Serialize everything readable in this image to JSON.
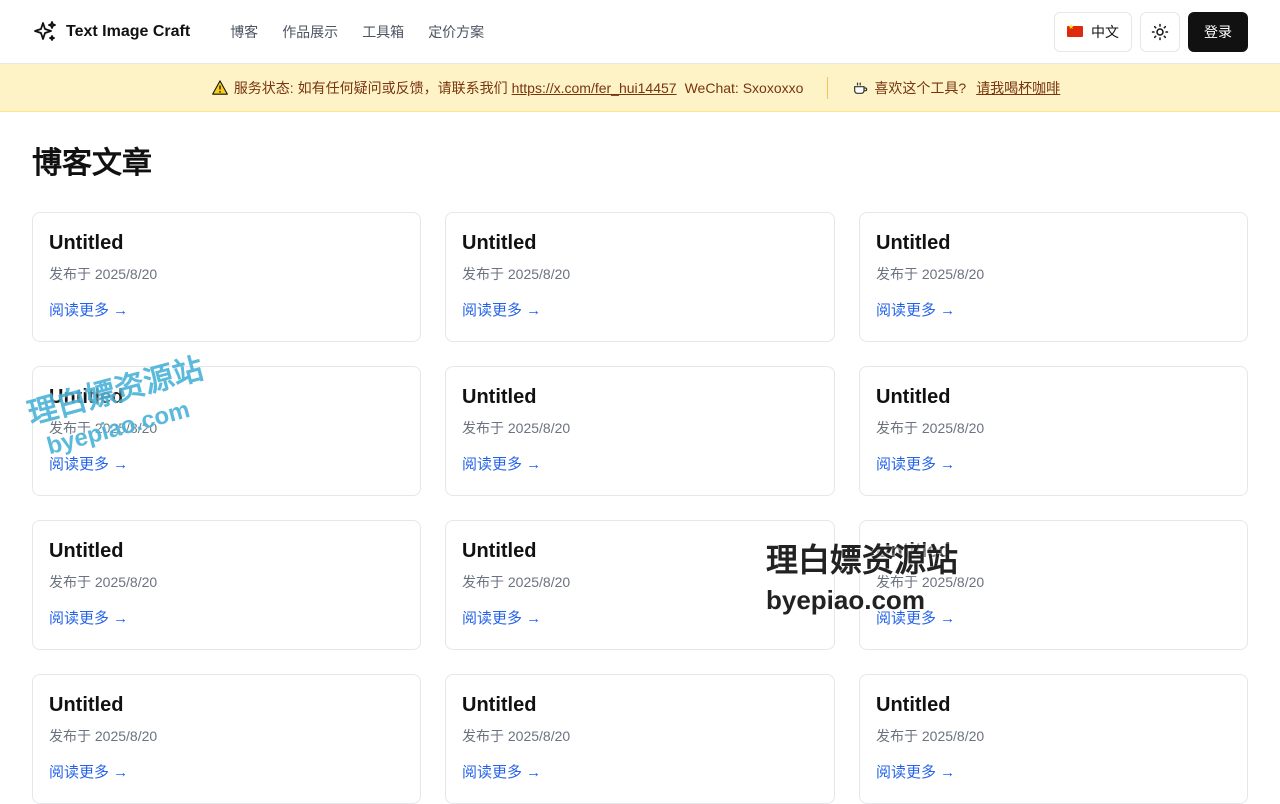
{
  "brand": {
    "name": "Text Image Craft"
  },
  "nav": {
    "items": [
      "博客",
      "作品展示",
      "工具箱",
      "定价方案"
    ]
  },
  "header": {
    "lang_label": "中文",
    "login_label": "登录"
  },
  "banner": {
    "status_text": "服务状态: 如有任何疑问或反馈，请联系我们",
    "link": "https://x.com/fer_hui14457",
    "wechat": "WeChat: Sxoxoxxo",
    "coffee_text": "喜欢这个工具?",
    "coffee_link": "请我喝杯咖啡"
  },
  "page": {
    "title": "博客文章"
  },
  "posts": [
    {
      "title": "Untitled",
      "date": "发布于 2025/8/20",
      "link": "阅读更多 →"
    },
    {
      "title": "Untitled",
      "date": "发布于 2025/8/20",
      "link": "阅读更多 →"
    },
    {
      "title": "Untitled",
      "date": "发布于 2025/8/20",
      "link": "阅读更多 →"
    },
    {
      "title": "Untitled",
      "date": "发布于 2025/8/20",
      "link": "阅读更多 →"
    },
    {
      "title": "Untitled",
      "date": "发布于 2025/8/20",
      "link": "阅读更多 →"
    },
    {
      "title": "Untitled",
      "date": "发布于 2025/8/20",
      "link": "阅读更多 →"
    },
    {
      "title": "Untitled",
      "date": "发布于 2025/8/20",
      "link": "阅读更多 →"
    },
    {
      "title": "Untitled",
      "date": "发布于 2025/8/20",
      "link": "阅读更多 →"
    },
    {
      "title": "Untitled",
      "date": "发布于 2025/8/20",
      "link": "阅读更多 →"
    },
    {
      "title": "Untitled",
      "date": "发布于 2025/8/20",
      "link": "阅读更多 →"
    },
    {
      "title": "Untitled",
      "date": "发布于 2025/8/20",
      "link": "阅读更多 →"
    },
    {
      "title": "Untitled",
      "date": "发布于 2025/8/20",
      "link": "阅读更多 →"
    }
  ],
  "watermark": {
    "name": "理白嫖资源站",
    "site": "byepiao.com"
  },
  "colors": {
    "accent": "#2563eb",
    "banner_bg": "#fef3c7",
    "button_dark": "#111111"
  },
  "icons": {
    "brand": "sparkles-icon",
    "theme": "sun-icon",
    "warning": "warning-icon",
    "coffee": "coffee-icon",
    "flag": "cn-flag-icon"
  }
}
